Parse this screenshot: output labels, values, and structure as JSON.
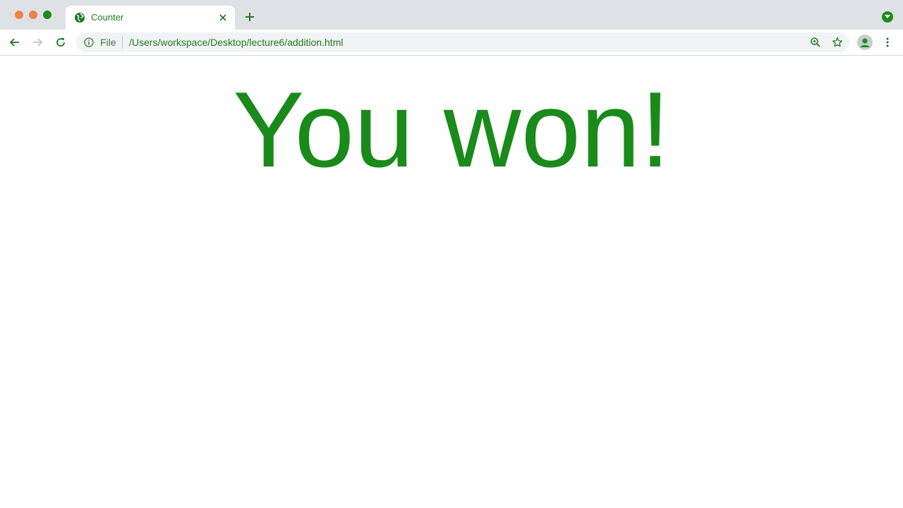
{
  "browser": {
    "tab": {
      "title": "Counter",
      "favicon_icon": "globe-icon"
    },
    "address_bar": {
      "scheme_label": "File",
      "url": "/Users/workspace/Desktop/lecture6/addition.html"
    },
    "colors": {
      "accent": "#1e8a1e",
      "traffic_close": "#f0814a",
      "traffic_minimize": "#f0814a",
      "traffic_maximize": "#1e8a1e"
    }
  },
  "page": {
    "heading": "You won!",
    "heading_color": "#1a8a1a"
  }
}
